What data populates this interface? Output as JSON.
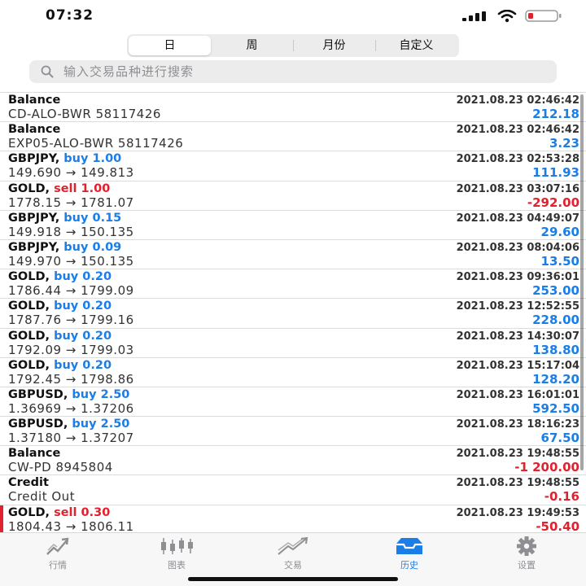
{
  "status": {
    "time": "07:32"
  },
  "segments": [
    {
      "label": "日",
      "active": true
    },
    {
      "label": "周",
      "active": false
    },
    {
      "label": "月份",
      "active": false
    },
    {
      "label": "自定义",
      "active": false
    }
  ],
  "search": {
    "placeholder": "输入交易品种进行搜索"
  },
  "rows": [
    {
      "symbol": "Balance",
      "side_text": "",
      "side": "",
      "sub": "CD-ALO-BWR 58117426",
      "time": "2021.08.23 02:46:42",
      "profit": "212.18",
      "profit_sign": "pos"
    },
    {
      "symbol": "Balance",
      "side_text": "",
      "side": "",
      "sub": "EXP05-ALO-BWR 58117426",
      "time": "2021.08.23 02:46:42",
      "profit": "3.23",
      "profit_sign": "pos"
    },
    {
      "symbol": "GBPJPY,",
      "side_text": "buy 1.00",
      "side": "buy",
      "sub": "149.690 → 149.813",
      "time": "2021.08.23 02:53:28",
      "profit": "111.93",
      "profit_sign": "pos"
    },
    {
      "symbol": "GOLD,",
      "side_text": "sell 1.00",
      "side": "sell",
      "sub": "1778.15 → 1781.07",
      "time": "2021.08.23 03:07:16",
      "profit": "-292.00",
      "profit_sign": "neg"
    },
    {
      "symbol": "GBPJPY,",
      "side_text": "buy 0.15",
      "side": "buy",
      "sub": "149.918 → 150.135",
      "time": "2021.08.23 04:49:07",
      "profit": "29.60",
      "profit_sign": "pos"
    },
    {
      "symbol": "GBPJPY,",
      "side_text": "buy 0.09",
      "side": "buy",
      "sub": "149.970 → 150.135",
      "time": "2021.08.23 08:04:06",
      "profit": "13.50",
      "profit_sign": "pos"
    },
    {
      "symbol": "GOLD,",
      "side_text": "buy 0.20",
      "side": "buy",
      "sub": "1786.44 → 1799.09",
      "time": "2021.08.23 09:36:01",
      "profit": "253.00",
      "profit_sign": "pos"
    },
    {
      "symbol": "GOLD,",
      "side_text": "buy 0.20",
      "side": "buy",
      "sub": "1787.76 → 1799.16",
      "time": "2021.08.23 12:52:55",
      "profit": "228.00",
      "profit_sign": "pos"
    },
    {
      "symbol": "GOLD,",
      "side_text": "buy 0.20",
      "side": "buy",
      "sub": "1792.09 → 1799.03",
      "time": "2021.08.23 14:30:07",
      "profit": "138.80",
      "profit_sign": "pos"
    },
    {
      "symbol": "GOLD,",
      "side_text": "buy 0.20",
      "side": "buy",
      "sub": "1792.45 → 1798.86",
      "time": "2021.08.23 15:17:04",
      "profit": "128.20",
      "profit_sign": "pos"
    },
    {
      "symbol": "GBPUSD,",
      "side_text": "buy 2.50",
      "side": "buy",
      "sub": "1.36969 → 1.37206",
      "time": "2021.08.23 16:01:01",
      "profit": "592.50",
      "profit_sign": "pos"
    },
    {
      "symbol": "GBPUSD,",
      "side_text": "buy 2.50",
      "side": "buy",
      "sub": "1.37180 → 1.37207",
      "time": "2021.08.23 18:16:23",
      "profit": "67.50",
      "profit_sign": "pos"
    },
    {
      "symbol": "Balance",
      "side_text": "",
      "side": "",
      "sub": "CW-PD 8945804",
      "time": "2021.08.23 19:48:55",
      "profit": "-1 200.00",
      "profit_sign": "neg"
    },
    {
      "symbol": "Credit",
      "side_text": "",
      "side": "",
      "sub": "Credit Out",
      "time": "2021.08.23 19:48:55",
      "profit": "-0.16",
      "profit_sign": "neg"
    },
    {
      "symbol": "GOLD,",
      "side_text": "sell 0.30",
      "side": "sell",
      "sub": "1804.43 → 1806.11",
      "time": "2021.08.23 19:49:53",
      "profit": "-50.40",
      "profit_sign": "neg",
      "marked": true
    }
  ],
  "tabs": [
    {
      "label": "行情",
      "icon": "quotes-icon",
      "active": false
    },
    {
      "label": "图表",
      "icon": "chart-candles-icon",
      "active": false
    },
    {
      "label": "交易",
      "icon": "trade-icon",
      "active": false
    },
    {
      "label": "历史",
      "icon": "history-icon",
      "active": true
    },
    {
      "label": "设置",
      "icon": "gear-icon",
      "active": false
    }
  ],
  "colors": {
    "buy": "#1a7ee6",
    "sell": "#e0212e",
    "active_tab": "#1a7ee6",
    "inactive_tab": "#8e8e93"
  }
}
